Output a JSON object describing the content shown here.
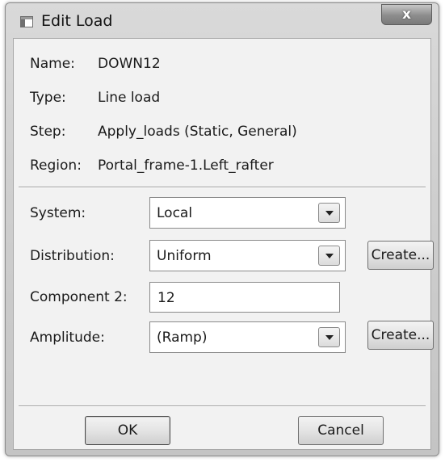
{
  "window": {
    "title": "Edit Load",
    "close_symbol": "x"
  },
  "info": {
    "name_label": "Name:",
    "name_value": "DOWN12",
    "type_label": "Type:",
    "type_value": "Line load",
    "step_label": "Step:",
    "step_value": "Apply_loads (Static, General)",
    "region_label": "Region:",
    "region_value": "Portal_frame-1.Left_rafter"
  },
  "form": {
    "system_label": "System:",
    "system_value": "Local",
    "distribution_label": "Distribution:",
    "distribution_value": "Uniform",
    "distribution_create_label": "Create...",
    "component_label": "Component 2:",
    "component_value": "12",
    "amplitude_label": "Amplitude:",
    "amplitude_value": "(Ramp)",
    "amplitude_create_label": "Create..."
  },
  "buttons": {
    "ok_label": "OK",
    "cancel_label": "Cancel"
  }
}
